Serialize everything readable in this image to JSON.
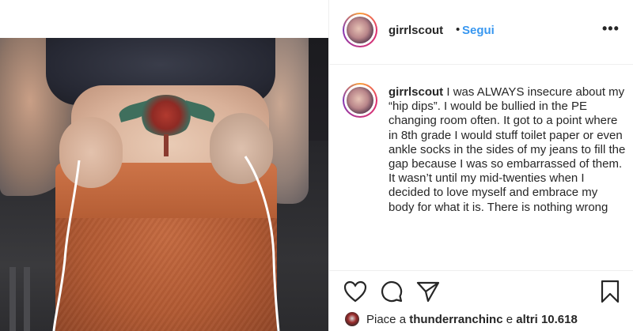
{
  "post": {
    "username": "girrlscout",
    "separator": "•",
    "follow_label": "Segui",
    "more_label": "•••",
    "caption_username": "girrlscout",
    "caption_text": "I was ALWAYS insecure about my “hip dips”. I would be bullied in the PE changing room often. It got to a point where in 8th grade I would stuff toilet paper or even ankle socks in the sides of my jeans to fill the gap because I was so embarrassed of them. It wasn’t until my mid-twenties when I decided to love myself and embrace my body for what it is. There is nothing wrong",
    "likes_prefix": "Piace a",
    "likes_user": "thunderranchinc",
    "likes_middle": "e",
    "likes_others": "altri 10.618"
  },
  "icons": {
    "like": "heart-icon",
    "comment": "comment-icon",
    "share": "send-icon",
    "save": "bookmark-icon",
    "more": "more-options-icon"
  },
  "colors": {
    "follow": "#3897f0",
    "text": "#262626",
    "divider": "#efefef"
  }
}
